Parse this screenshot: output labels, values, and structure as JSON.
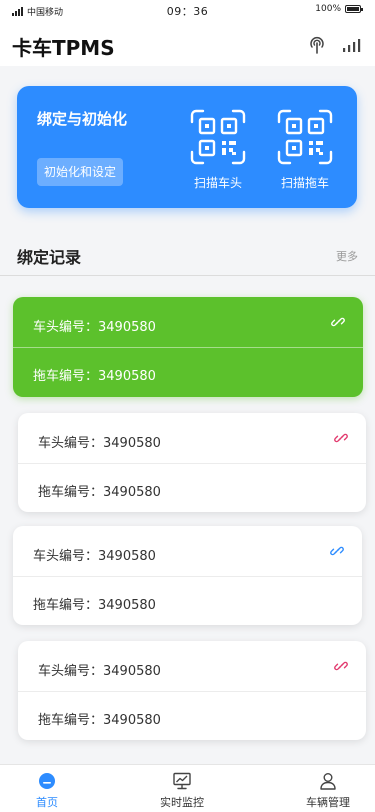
{
  "status_bar": {
    "carrier": "中国移动",
    "time": "09：36",
    "battery": "100%",
    "battery_level": 1.0
  },
  "header": {
    "title": "卡车TPMS",
    "icons": [
      "antenna-icon",
      "signal-icon"
    ]
  },
  "hero": {
    "title": "绑定与初始化",
    "init_button": "初始化和设定",
    "scan_head_label": "扫描车头",
    "scan_trailer_label": "扫描拖车",
    "background_color": "#2d8cff"
  },
  "records_section": {
    "title": "绑定记录",
    "more_label": "更多"
  },
  "records": [
    {
      "head": "车头编号：3490580",
      "trailer": "拖车编号：3490580",
      "active": true,
      "link_color": "#ffffff"
    },
    {
      "head": "车头编号：3490580",
      "trailer": "拖车编号：3490580",
      "active": false,
      "link_color": "#e23a6e"
    },
    {
      "head": "车头编号：3490580",
      "trailer": "拖车编号：3490580",
      "active": false,
      "link_color": "#2d8cff"
    },
    {
      "head": "车头编号：3490580",
      "trailer": "拖车编号：3490580",
      "active": false,
      "link_color": "#e23a6e"
    }
  ],
  "tab_bar": {
    "items": [
      {
        "label": "首页",
        "icon": "home-icon",
        "active": true
      },
      {
        "label": "实时监控",
        "icon": "monitor-icon",
        "active": false
      },
      {
        "label": "车辆管理",
        "icon": "user-icon",
        "active": false
      }
    ],
    "accent_color": "#2d8cff"
  }
}
